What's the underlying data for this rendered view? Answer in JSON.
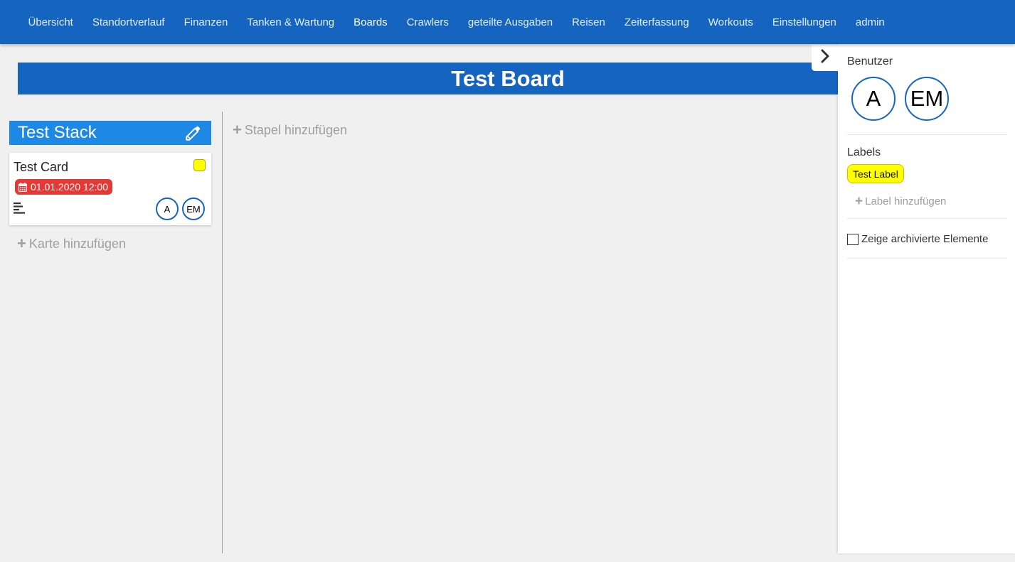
{
  "nav": {
    "items": [
      {
        "label": "Übersicht",
        "active": false
      },
      {
        "label": "Standortverlauf",
        "active": false
      },
      {
        "label": "Finanzen",
        "active": false
      },
      {
        "label": "Tanken & Wartung",
        "active": false
      },
      {
        "label": "Boards",
        "active": true
      },
      {
        "label": "Crawlers",
        "active": false
      },
      {
        "label": "geteilte Ausgaben",
        "active": false
      },
      {
        "label": "Reisen",
        "active": false
      },
      {
        "label": "Zeiterfassung",
        "active": false
      },
      {
        "label": "Workouts",
        "active": false
      },
      {
        "label": "Einstellungen",
        "active": false
      },
      {
        "label": "admin",
        "active": false
      }
    ]
  },
  "board": {
    "title": "Test Board",
    "stack": {
      "title": "Test Stack",
      "edit_icon": "pencil-icon",
      "card": {
        "title": "Test Card",
        "label_color": "#ffff00",
        "due_date": "01.01.2020 12:00",
        "due_icon": "calendar-icon",
        "description_icon": "description-icon",
        "users": [
          "A",
          "EM"
        ]
      },
      "add_card": "Karte hinzufügen"
    },
    "add_stack": "Stapel hinzufügen"
  },
  "sidebar": {
    "toggle_icon": "chevron-right-icon",
    "users_heading": "Benutzer",
    "users": [
      "A",
      "EM"
    ],
    "labels_heading": "Labels",
    "labels": [
      {
        "name": "Test Label",
        "color": "#ffff00"
      }
    ],
    "add_label": "Label hinzufügen",
    "show_archived": "Zeige archivierte Elemente",
    "show_archived_checked": false
  },
  "colors": {
    "primary": "#1565c0",
    "stack_header": "#1e88e5",
    "due_badge": "#e53935",
    "label_yellow": "#ffff00"
  }
}
